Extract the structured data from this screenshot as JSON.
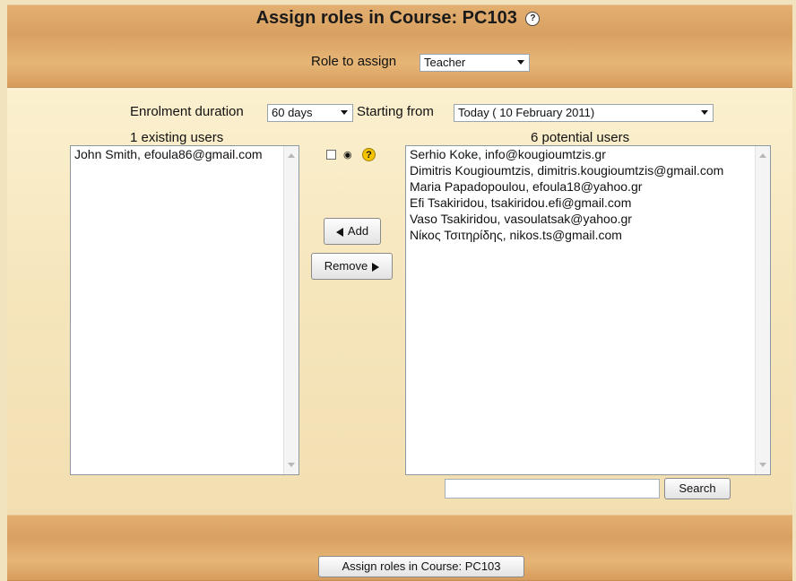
{
  "page": {
    "title": "Assign roles in Course: PC103",
    "title_help_icon": "question-circle-icon"
  },
  "role": {
    "label": "Role to assign",
    "selected": "Teacher"
  },
  "enrolment": {
    "label": "Enrolment duration",
    "duration": "60 days",
    "start_label": "Starting from",
    "start_value": "Today ( 10 February 2011)"
  },
  "existing_users": {
    "heading": "1 existing users",
    "items": [
      "John Smith, efoula86@gmail.com"
    ]
  },
  "potential_users": {
    "heading": "6 potential users",
    "items": [
      "Serhio Koke, info@kougioumtzis.gr",
      "Dimitris Kougioumtzis, dimitris.kougioumtzis@gmail.com",
      "Maria Papadopoulou, efoula18@yahoo.gr",
      "Efi Tsakiridou, tsakiridou.efi@gmail.com",
      "Vaso Tsakiridou, vasoulatsak@yahoo.gr",
      "Νίκος Τσιτηρίδης, nikos.ts@gmail.com"
    ]
  },
  "controls": {
    "add_label": "Add",
    "remove_label": "Remove",
    "search_label": "Search",
    "search_value": "",
    "submit_label": "Assign roles in Course: PC103",
    "checkbox_checked": false,
    "hidden_icon": "eye-icon",
    "help_icon": "help-question-icon"
  },
  "colors": {
    "band": "#dca466",
    "panel": "#f6e6bd",
    "help_icon": "#f5c400"
  }
}
